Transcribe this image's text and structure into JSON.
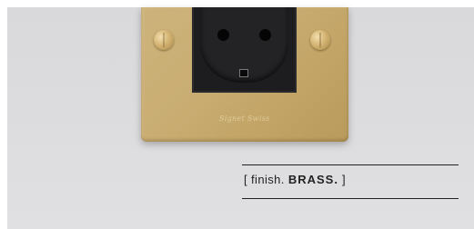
{
  "photo": {
    "description_tags": [
      "wall-socket",
      "brass-plate"
    ],
    "plate_color": "#c9ad72",
    "socket_color": "#1d1d1f",
    "wall_color": "#dcdcde",
    "engraving_text": "Signet Swiss"
  },
  "caption": {
    "open_bracket": "[",
    "label": "finish.",
    "value": "BRASS.",
    "close_bracket": "]",
    "text_color": "#222222"
  }
}
